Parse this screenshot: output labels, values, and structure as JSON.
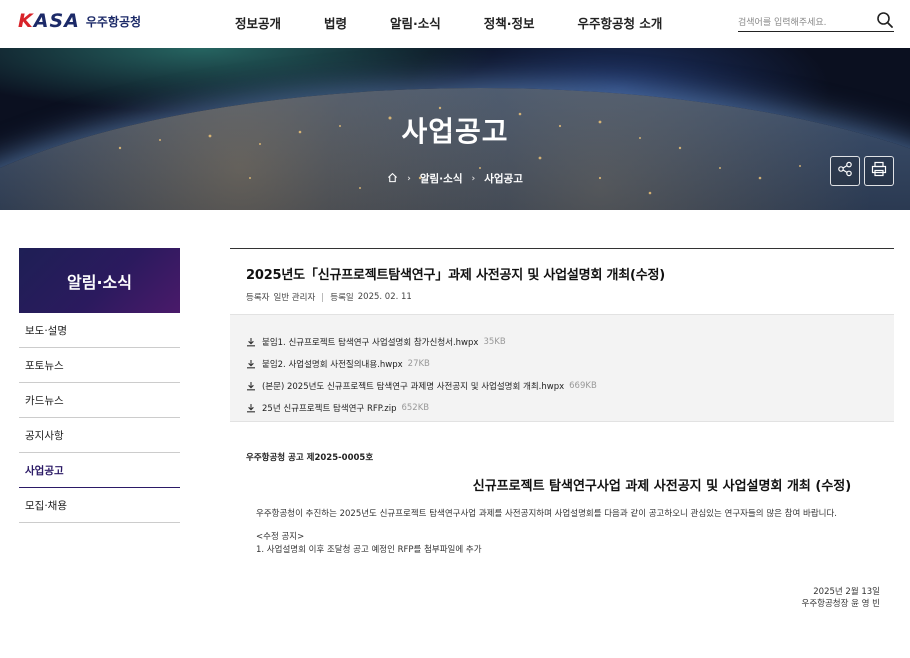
{
  "header": {
    "logo_mark": "KASA",
    "logo_text": "우주항공청",
    "nav": [
      "정보공개",
      "법령",
      "알림·소식",
      "정책·정보",
      "우주항공청 소개"
    ],
    "search_placeholder": "검색어를 입력해주세요."
  },
  "banner": {
    "title": "사업공고",
    "breadcrumb": [
      "알림·소식",
      "사업공고"
    ],
    "icons": [
      "home-icon",
      "share-icon",
      "print-icon"
    ]
  },
  "sidebar": {
    "title": "알림·소식",
    "items": [
      "보도·설명",
      "포토뉴스",
      "카드뉴스",
      "공지사항",
      "사업공고",
      "모집·채용"
    ],
    "active": "사업공고"
  },
  "article": {
    "title": "2025년도「신규프로젝트탐색연구」과제 사전공지 및 사업설명회 개최(수정)",
    "author_label": "등록자",
    "author": "일반 관리자",
    "date_label": "등록일",
    "date": "2025. 02. 11",
    "files": [
      {
        "name": "붙임1. 신규프로젝트 탐색연구 사업설명회 참가신청서.hwpx",
        "size": "35KB"
      },
      {
        "name": "붙임2. 사업설명회 사전질의내용.hwpx",
        "size": "27KB"
      },
      {
        "name": "(본문) 2025년도 신규프로젝트 탐색연구 과제명 사전공지 및 사업설명회 개최.hwpx",
        "size": "669KB"
      },
      {
        "name": "25년 신규프로젝트 탐색연구 RFP.zip",
        "size": "652KB"
      }
    ],
    "notice_no": "우주항공청 공고 제2025-0005호",
    "notice_title": "신규프로젝트 탐색연구사업 과제 사전공지 및 사업설명회 개최 (수정)",
    "paragraph": "우주항공청이 추진하는 2025년도 신규프로젝트 탐색연구사업 과제를 사전공지하며 사업설명회를 다음과 같이 공고하오니 관심있는 연구자들의 많은 참여 바랍니다.",
    "revision_heading": "<수정 공지>",
    "revision_item": "1. 사업설명회 이후 조달청 공고 예정인 RFP를 첨부파일에 추가",
    "sign_date": "2025년 2월 13일",
    "sign_name": "우주항공청장 윤 영 빈"
  },
  "colors": {
    "brand_navy": "#1c2a68",
    "brand_red": "#d8232a",
    "sidebar_gradient_start": "#1e1f55",
    "sidebar_gradient_end": "#4a1a6a",
    "active_text": "#2b1a66"
  }
}
